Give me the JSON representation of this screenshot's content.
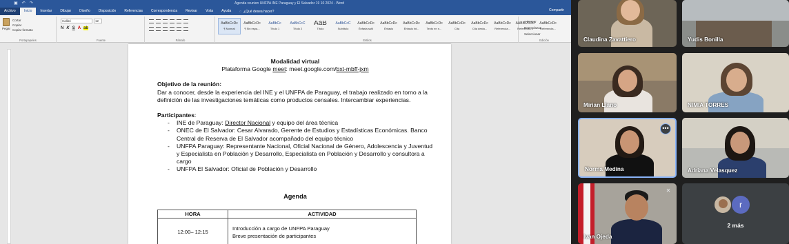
{
  "word": {
    "title_bar": "Agenda reunion UNFPA INE Paraguay y El Salvador 19 10 2024 - Word",
    "account": "",
    "tabs": [
      "Archivo",
      "Inicio",
      "Insertar",
      "Dibujar",
      "Diseño",
      "Disposición",
      "Referencias",
      "Correspondencia",
      "Revisar",
      "Vista",
      "Ayuda"
    ],
    "active_tab": "Inicio",
    "tell_me": "¿Qué desea hacer?",
    "share": "Compartir",
    "ribbon": {
      "paste": "Pegar",
      "clipboard_items": [
        "Cortar",
        "Copiar",
        "Copiar formato"
      ],
      "font_name": "Calibri",
      "font_size": "12",
      "groups": [
        "Portapapeles",
        "Fuente",
        "Párrafo",
        "Estilos",
        "Edición"
      ],
      "styles": [
        {
          "preview": "AaBbCcDc",
          "name": "¶ Normal"
        },
        {
          "preview": "AaBbCcDc",
          "name": "¶ Sin espa..."
        },
        {
          "preview": "AaBbCc",
          "name": "Título 1"
        },
        {
          "preview": "AaBbCcC",
          "name": "Título 2"
        },
        {
          "preview": "AaB",
          "name": "Título"
        },
        {
          "preview": "AaBbCcC",
          "name": "Subtítulo"
        },
        {
          "preview": "AaBbCcDc",
          "name": "Énfasis sutil"
        },
        {
          "preview": "AaBbCcDc",
          "name": "Énfasis"
        },
        {
          "preview": "AaBbCcDc",
          "name": "Énfasis int..."
        },
        {
          "preview": "AaBbCcDc",
          "name": "Texto en n..."
        },
        {
          "preview": "AaBbCcDc",
          "name": "Cita"
        },
        {
          "preview": "AaBbCcDc",
          "name": "Cita desta..."
        },
        {
          "preview": "AaBbCcDc",
          "name": "Referencia..."
        },
        {
          "preview": "AABBCCDC",
          "name": "Referencia..."
        },
        {
          "preview": "AaBbCcDc",
          "name": "Referencia..."
        }
      ],
      "editing": [
        "Buscar",
        "Reemplazar",
        "Seleccionar"
      ]
    }
  },
  "doc": {
    "modalidad": "Modalidad virtual",
    "plataforma_prefix": "Plataforma Google ",
    "plataforma_meet": "meet",
    "plataforma_mid": ": meet.google.com/",
    "plataforma_code": "bxt-mbff-jxm",
    "objetivo_title": "Objetivo de la reunión:",
    "objetivo_text": "Dar a conocer, desde la experiencia del INE y el UNFPA de Paraguay, el trabajo realizado en torno a la definición de las investigaciones temáticas como productos censales. Intercambiar experiencias.",
    "participantes_title": "Participantes",
    "participantes_colon": ":",
    "participantes": [
      {
        "pre": "INE de Paraguay: ",
        "link": "Director Nacional",
        "post": " y equipo del área técnica"
      },
      {
        "pre": "ONEC de El Salvador:  Cesar Alvarado, Gerente de Estudios y Estadísticas Económicas. Banco Central de Reserva de El Salvador acompañado del equipo técnico",
        "link": "",
        "post": ""
      },
      {
        "pre": "UNFPA Paraguay: Representante Nacional, Oficial Nacional de Género, Adolescencia y Juventud y Especialista en Población y Desarrollo, Especialista en Población y Desarrollo y consultora a cargo",
        "link": "",
        "post": ""
      },
      {
        "pre": "UNFPA El Salvador: Oficial de Población y Desarrollo",
        "link": "",
        "post": ""
      }
    ],
    "agenda_title": "Agenda",
    "table": {
      "headers": [
        "HORA",
        "ACTIVIDAD"
      ],
      "rows": [
        {
          "hora": "12:00– 12:15",
          "actividad": [
            "Introducción a cargo de UNFPA Paraguay",
            "Breve presentación de participantes"
          ]
        }
      ]
    }
  },
  "meet": {
    "participants": [
      {
        "name": "Claudina Zavattiero"
      },
      {
        "name": "Yudis Bonilla"
      },
      {
        "name": "Mirian Llano"
      },
      {
        "name": "NIMIA TORRES"
      },
      {
        "name": "Norma Medina"
      },
      {
        "name": "Adriana Velasquez"
      },
      {
        "name": "Ivan Ojeda"
      }
    ],
    "more_avatar_letter": "r",
    "more_label": "2 más",
    "more_options_glyph": "•••",
    "muted_glyph": "✕"
  }
}
